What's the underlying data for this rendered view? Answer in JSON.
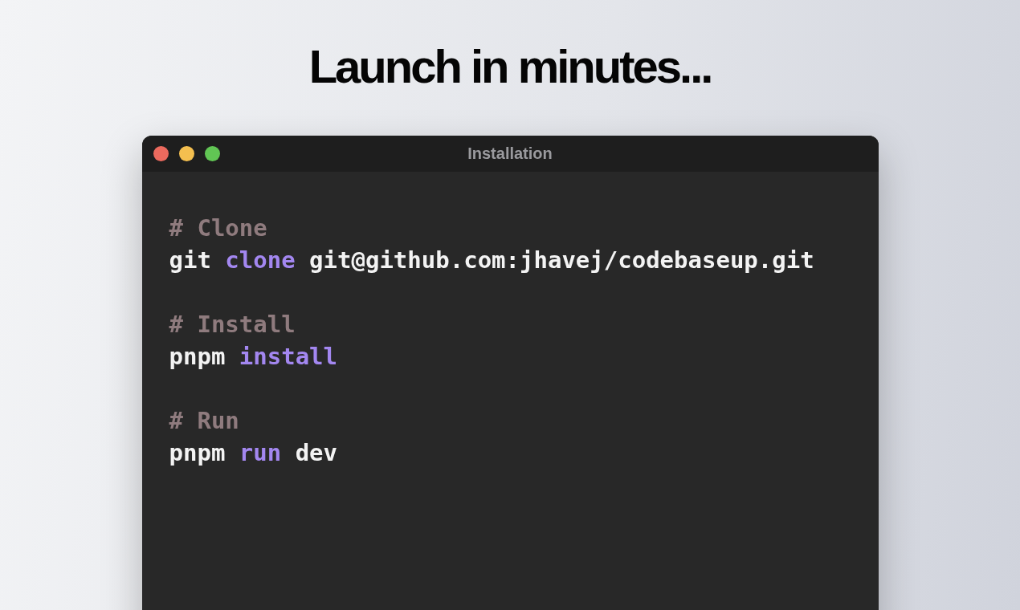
{
  "heading": "Launch in minutes...",
  "window": {
    "title": "Installation",
    "controls": [
      {
        "color": "#ec6a5e"
      },
      {
        "color": "#f4bf4f"
      },
      {
        "color": "#61c554"
      }
    ],
    "blocks": [
      {
        "lines": [
          [
            {
              "kind": "comment",
              "text": "# Clone"
            }
          ],
          [
            {
              "kind": "plain",
              "text": "git "
            },
            {
              "kind": "keyword",
              "text": "clone"
            },
            {
              "kind": "plain",
              "text": " git@github.com:jhavej/codebaseup.git"
            }
          ]
        ]
      },
      {
        "lines": [
          [
            {
              "kind": "comment",
              "text": "# Install"
            }
          ],
          [
            {
              "kind": "plain",
              "text": "pnpm "
            },
            {
              "kind": "keyword",
              "text": "install"
            }
          ]
        ]
      },
      {
        "lines": [
          [
            {
              "kind": "comment",
              "text": "# Run"
            }
          ],
          [
            {
              "kind": "plain",
              "text": "pnpm "
            },
            {
              "kind": "keyword",
              "text": "run"
            },
            {
              "kind": "plain",
              "text": " dev"
            }
          ]
        ]
      }
    ]
  }
}
